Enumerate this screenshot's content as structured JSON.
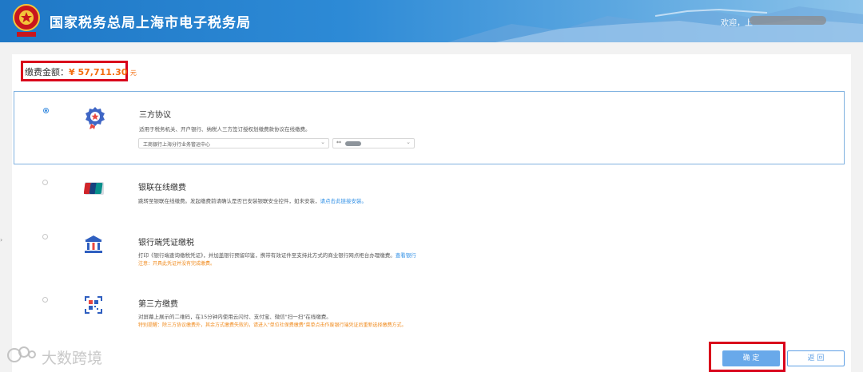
{
  "header": {
    "title": "国家税务总局上海市电子税务局",
    "welcome": "欢迎，上"
  },
  "payment": {
    "label": "缴费金额：",
    "value": "¥ 57,711.30",
    "unit": "元"
  },
  "options": [
    {
      "title": "三方协议",
      "desc": "适用于税务机关、开户银行、纳税人三方签订授权划缴费款协议在线缴费。",
      "bank_select": "工商银行上海分行业务管运中心",
      "account_prefix": "**",
      "selected": true
    },
    {
      "title": "银联在线缴费",
      "desc": "跳转至银联在线缴费。发起缴费前请确认是否已安装银联安全控件，如未安装，",
      "link": "请点击此链接安装。",
      "selected": false
    },
    {
      "title": "银行端凭证缴税",
      "desc": "打印《银行端查询缴税凭证》，并加盖银行预留印鉴，携带有效证件至支持此方式的商业银行网点柜台办理缴费。",
      "link": "查看银行",
      "note": "注意：开具此凭证并没有完成缴费。",
      "selected": false
    },
    {
      "title": "第三方缴费",
      "desc": "对屏幕上展示的二维码，在15分钟内使用云闪付、支付宝、微信\"扫一扫\"在线缴费。",
      "note": "特别提醒：除三方协议缴费外，其余方式缴费失败的，请进入\"单位社保费缴费\"菜单点击作废银行端凭证后重新选择缴费方式。",
      "selected": false
    }
  ],
  "buttons": {
    "confirm": "确 定",
    "back": "返 回"
  },
  "watermark": "大数跨境",
  "colors": {
    "header": "#1f78c6",
    "accent": "#3d8ee0",
    "amount": "#f36d0f",
    "highlight": "#d9001b"
  }
}
